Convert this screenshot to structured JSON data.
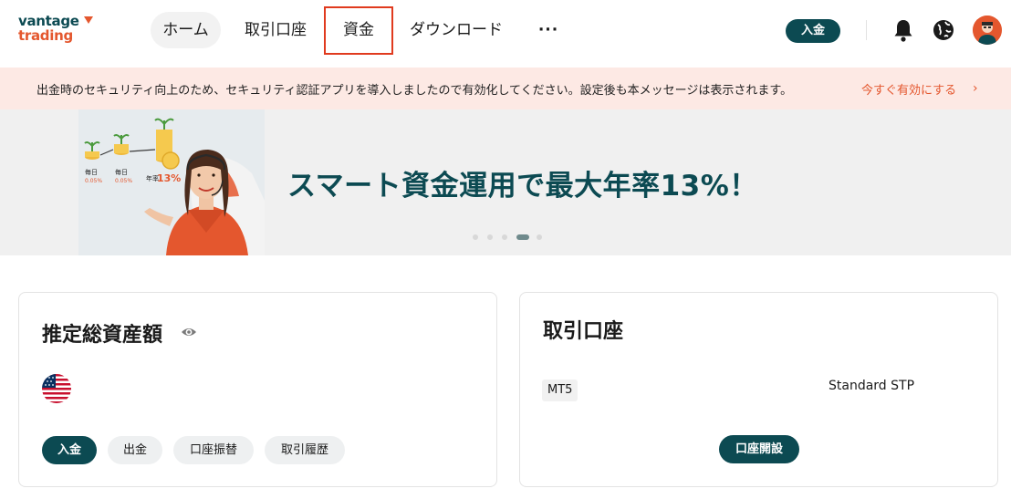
{
  "logo": {
    "line1": "vantage",
    "line2": "trading"
  },
  "nav": {
    "home": "ホーム",
    "accounts": "取引口座",
    "funds": "資金",
    "download": "ダウンロード",
    "more": "···"
  },
  "header": {
    "deposit_label": "入金"
  },
  "alert": {
    "message": "出金時のセキュリティ向上のため、セキュリティ認証アプリを導入しましたので有効化してください。設定後も本メッセージは表示されます。",
    "link": "今すぐ有効にする",
    "chevron": "›"
  },
  "hero": {
    "title": "スマート資金運用で最大年率13%！",
    "img_label_1": "毎日",
    "img_rate_1": "0.05%",
    "img_label_2": "毎日",
    "img_rate_2": "0.05%",
    "img_label_3": "年率",
    "img_rate_3": "13%",
    "slide_count": 5,
    "active_slide": 4
  },
  "assets_card": {
    "title": "推定総資産額",
    "buttons": {
      "deposit": "入金",
      "withdraw": "出金",
      "transfer": "口座振替",
      "history": "取引履歴"
    }
  },
  "accounts_card": {
    "title": "取引口座",
    "platform": "MT5",
    "account_type": "Standard STP",
    "open_button": "口座開設"
  },
  "colors": {
    "brand": "#0c4a52",
    "accent": "#e4572e",
    "highlight_border": "#e03a1e",
    "alert_bg": "#fde9e4"
  },
  "icons": {
    "bell": "bell-icon",
    "globe": "globe-icon",
    "eye": "eye-icon",
    "flag": "us-flag-icon",
    "avatar": "avatar"
  }
}
